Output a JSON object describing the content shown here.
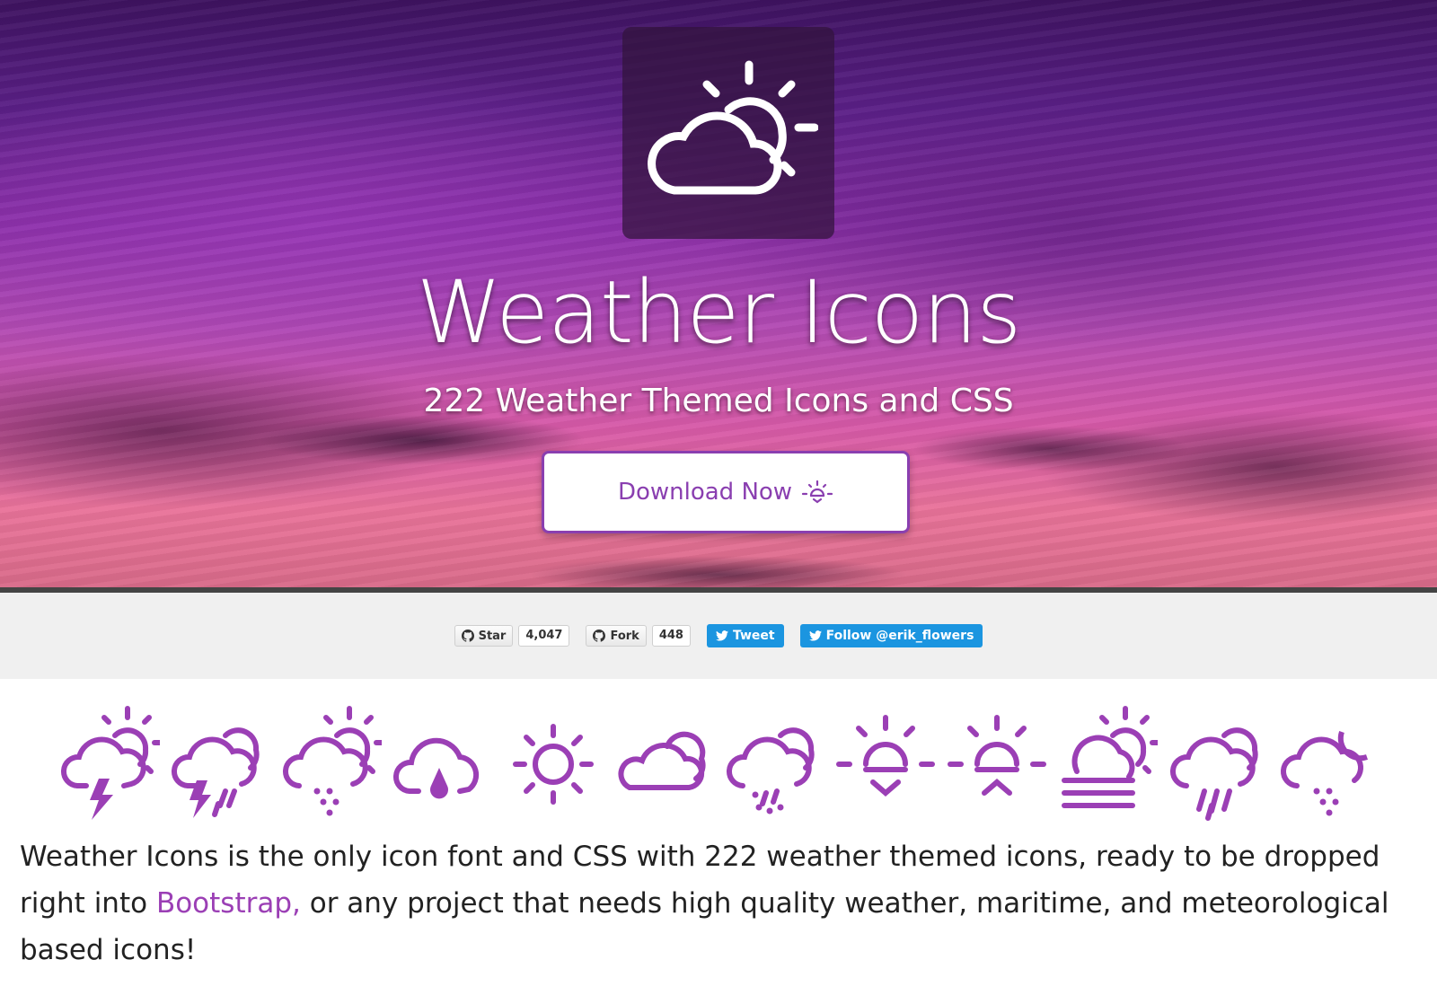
{
  "hero": {
    "title": "Weather Icons",
    "subtitle": "222 Weather Themed Icons and CSS",
    "download_label": "Download Now"
  },
  "social": {
    "star_label": "Star",
    "star_count": "4,047",
    "fork_label": "Fork",
    "fork_count": "448",
    "tweet_label": "Tweet",
    "follow_label": "Follow @erik_flowers"
  },
  "sample_icons": [
    "day-thunderstorm-icon",
    "thunderstorm-rain-icon",
    "day-snow-showers-icon",
    "cloud-raindrop-icon",
    "sunny-icon",
    "cloudy-icon",
    "rain-mix-icon",
    "sunrise-icon",
    "sunset-icon",
    "day-fog-icon",
    "rain-showers-icon",
    "night-snow-icon"
  ],
  "intro": {
    "text_before": "Weather Icons is the only icon font and CSS with 222 weather themed icons, ready to be dropped right into ",
    "link": "Bootstrap,",
    "text_after": " or any project that needs high quality weather, maritime, and meteorological based icons!"
  },
  "colors": {
    "accent": "#8a3fb0",
    "twitter": "#1b95e0"
  }
}
